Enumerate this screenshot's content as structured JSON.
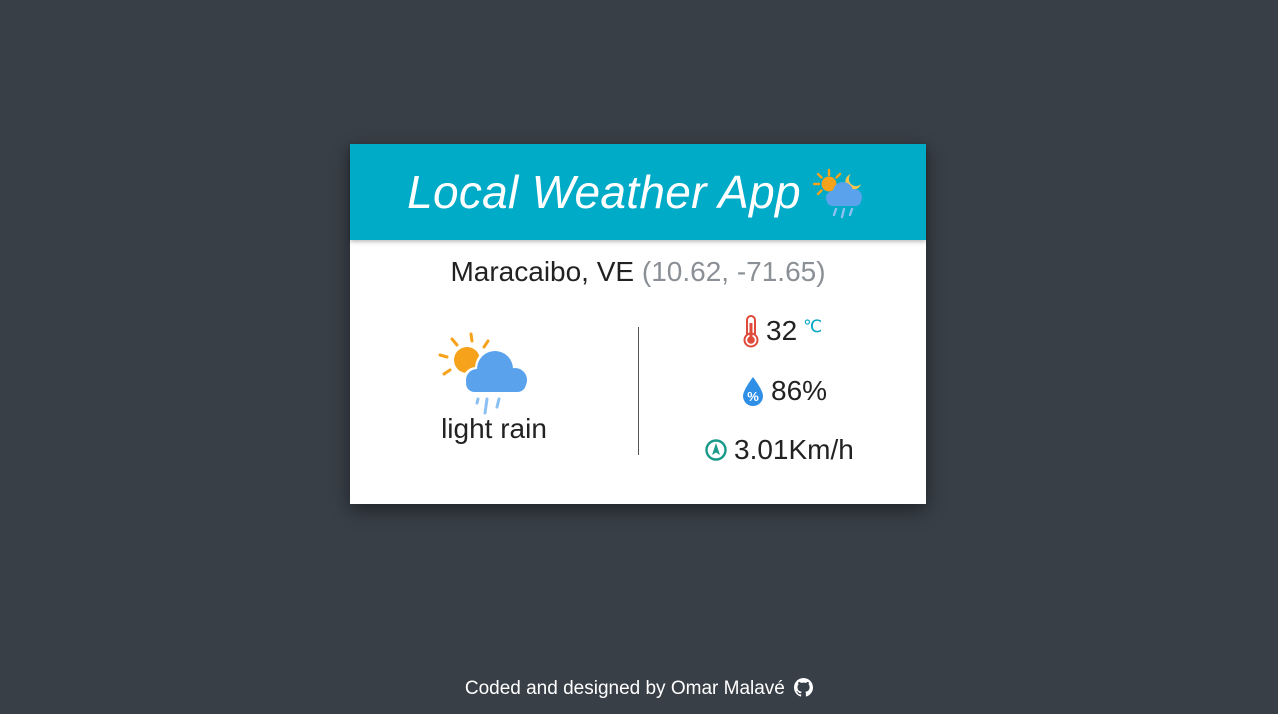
{
  "header": {
    "title": "Local Weather App",
    "icon": "sun-cloud-rain-icon"
  },
  "location": {
    "name": "Maracaibo, VE",
    "coords": "(10.62, -71.65)"
  },
  "conditions": {
    "description": "light rain",
    "icon": "partly-cloudy-rain-icon"
  },
  "stats": {
    "temperature": "32",
    "temperature_unit": "℃",
    "humidity": "86%",
    "wind": "3.01Km/h"
  },
  "footer": {
    "text": "Coded and designed by Omar Malavé",
    "icon": "github-icon"
  },
  "colors": {
    "background": "#383f47",
    "header": "#00abc7",
    "card": "#ffffff",
    "sun": "#f7a21b",
    "cloud": "#5aa3ec",
    "thermometer": "#e04a3a",
    "humidity": "#2f8fe6",
    "wind": "#1a9a8a"
  }
}
